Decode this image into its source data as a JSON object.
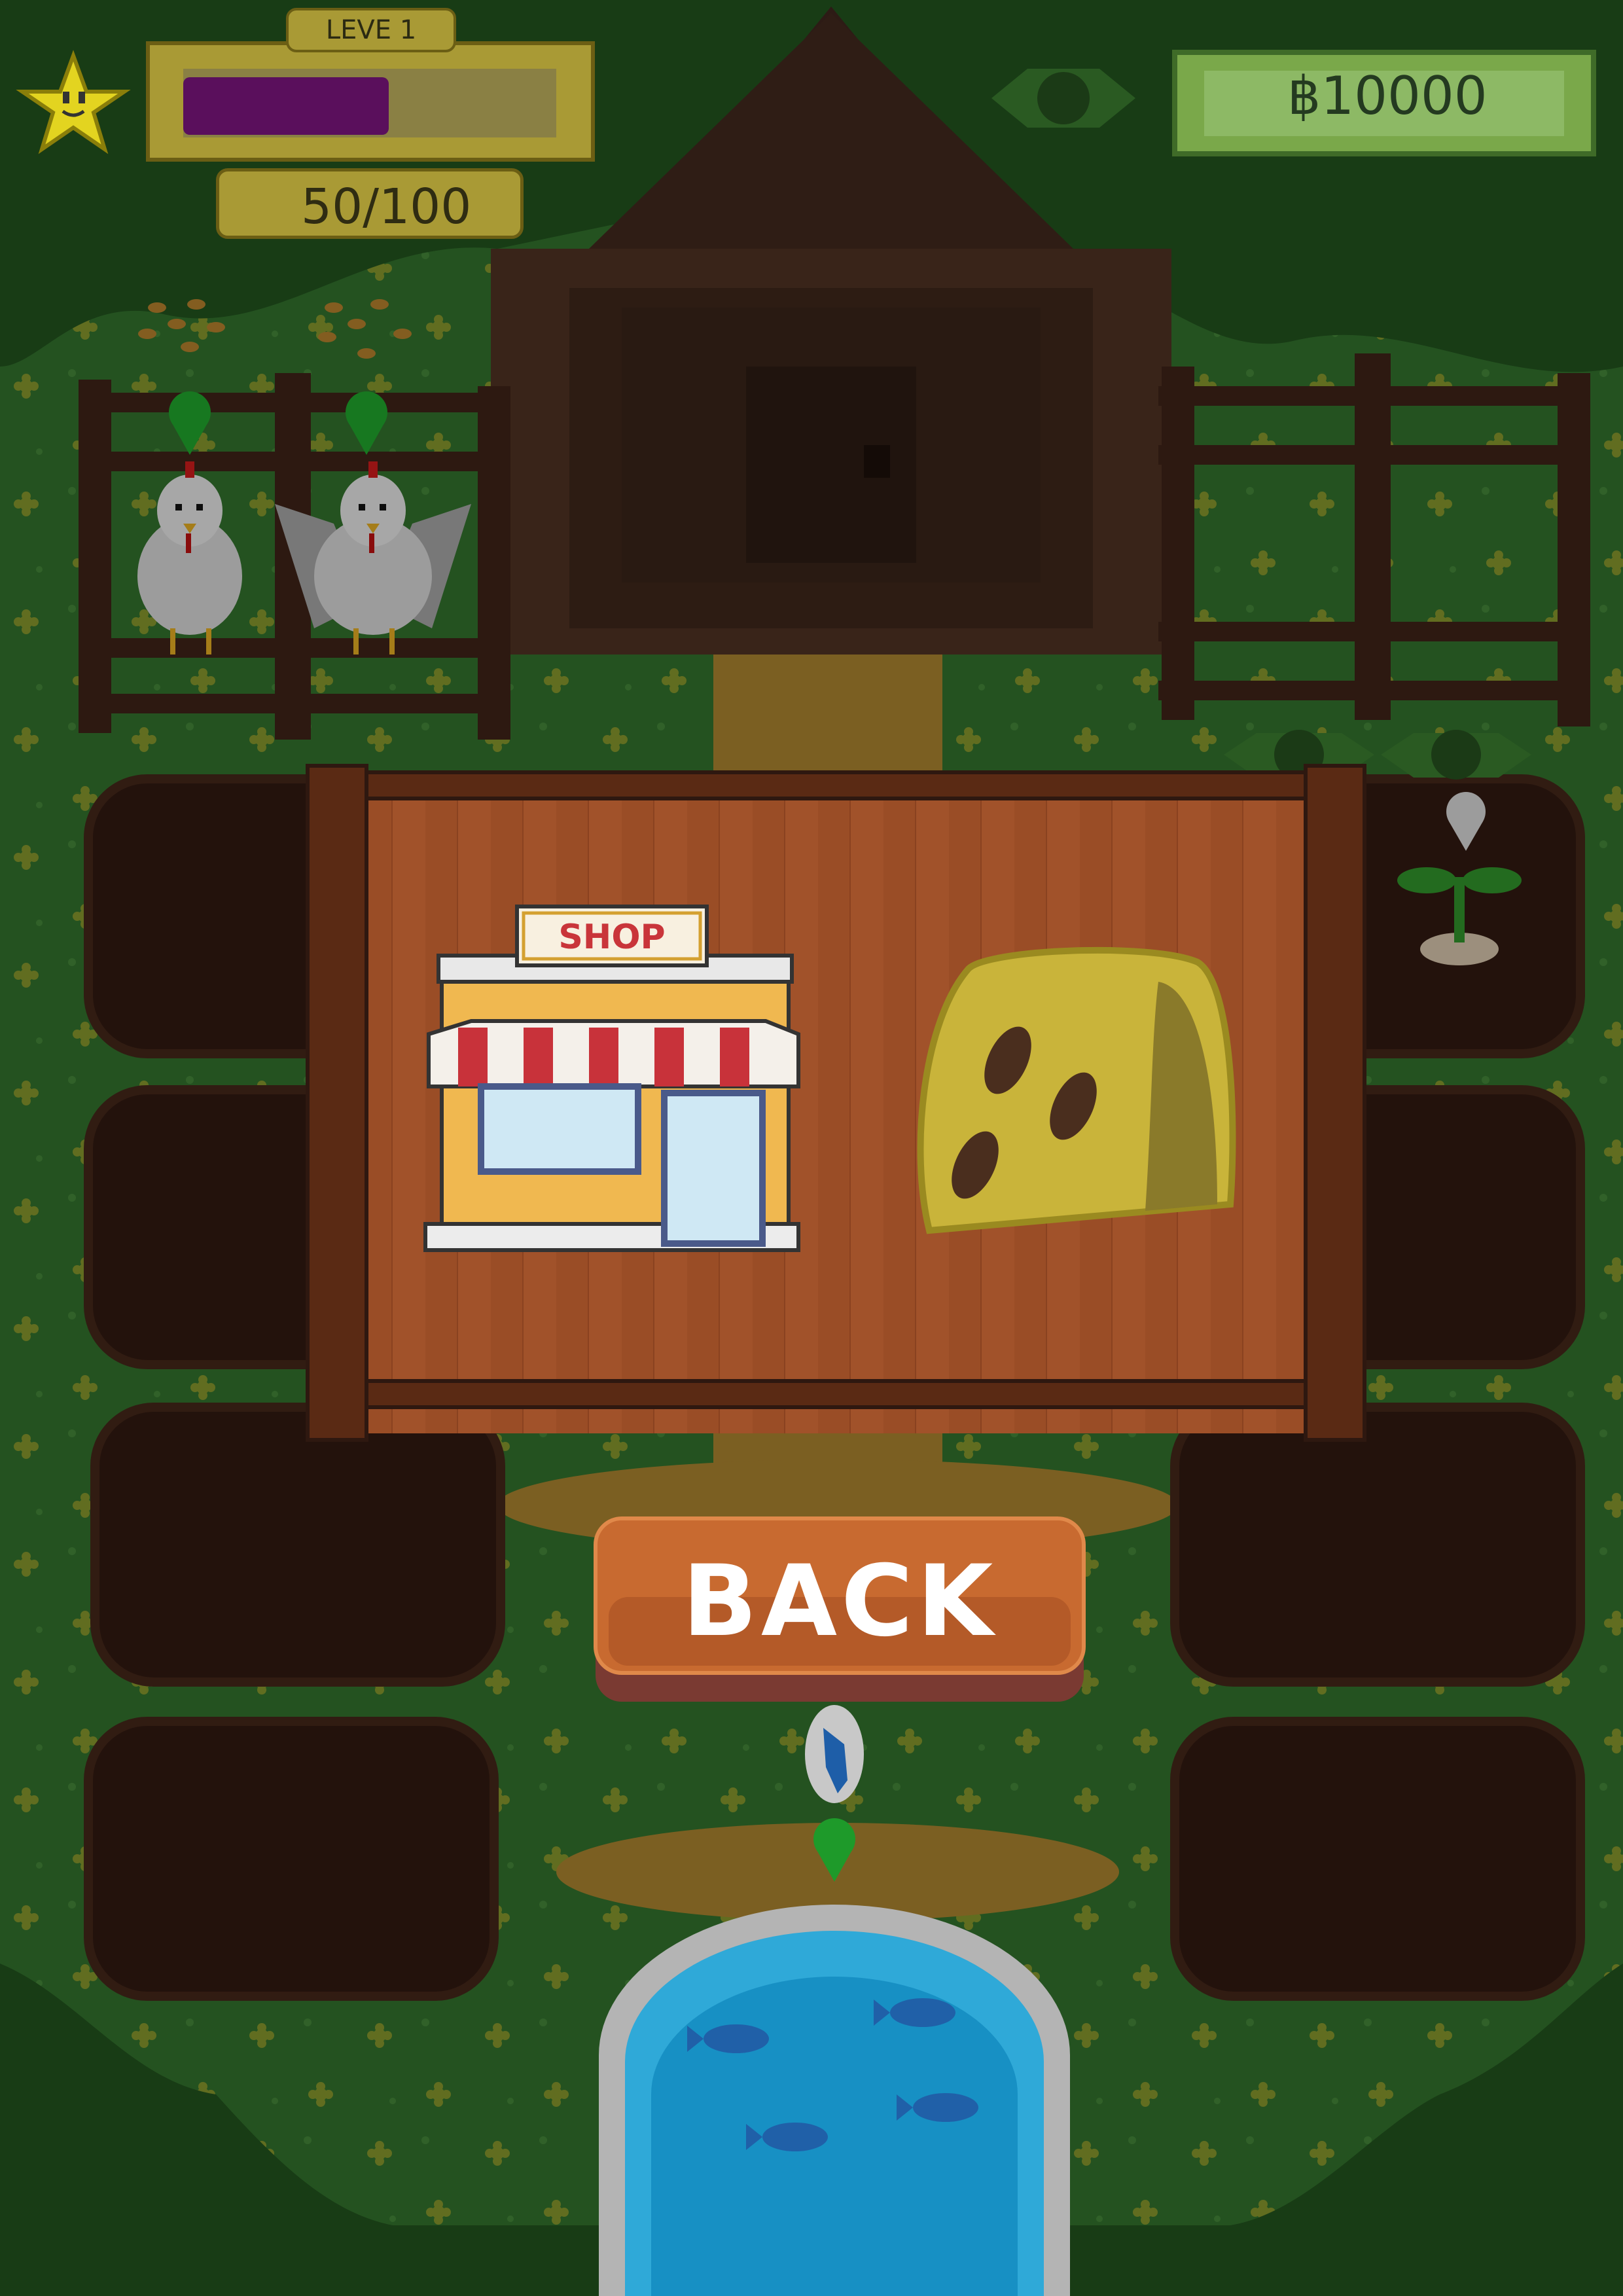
{
  "hud": {
    "level_label": "LEVE 1",
    "xp_progress": 0.55,
    "xp_count": "50/100",
    "money": "฿10000"
  },
  "overlay": {
    "shop_sign": "SHOP",
    "back_label": "BACK"
  },
  "colors": {
    "grass": "#2f6a2a",
    "dark_grass": "#1f4d1c",
    "soil": "#2e1810",
    "wood": "#4a2a1e",
    "panel": "#9a4d26",
    "xp_fill": "#5a0f5c",
    "money_bar": "#7aa84a",
    "water": "#1a9ad0"
  },
  "icons": {
    "star": "star-icon",
    "eye": "eye-icon",
    "seed_bag": "seed-bag-icon",
    "shop": "shop-building-icon",
    "fish": "fish-icon",
    "marker": "map-marker-icon"
  }
}
